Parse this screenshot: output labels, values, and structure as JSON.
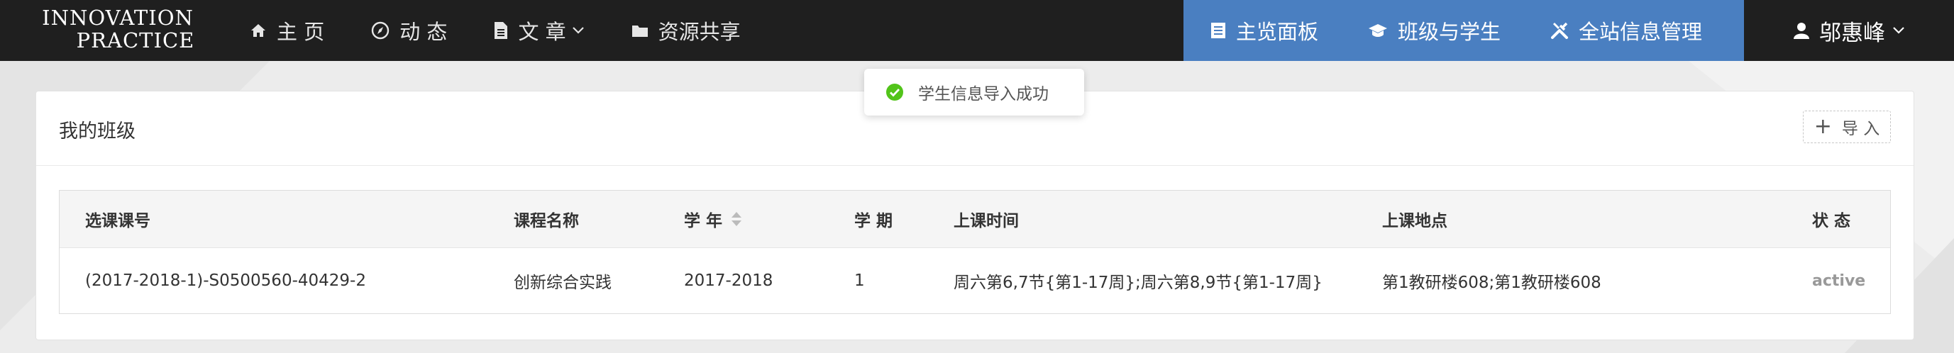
{
  "brand": {
    "line1": "INNOVATION",
    "line2": "PRACTICE"
  },
  "nav": {
    "items": [
      {
        "label": "主 页",
        "icon": "home-icon"
      },
      {
        "label": "动 态",
        "icon": "compass-icon"
      },
      {
        "label": "文 章",
        "icon": "document-icon"
      },
      {
        "label": "资源共享",
        "icon": "folder-icon"
      }
    ],
    "admin": [
      {
        "label": "主览面板",
        "icon": "list-icon"
      },
      {
        "label": "班级与学生",
        "icon": "graduation-cap-icon"
      },
      {
        "label": "全站信息管理",
        "icon": "wrench-icon"
      }
    ],
    "user": {
      "name": "邬惠峰",
      "icon": "user-icon"
    }
  },
  "toast": {
    "message": "学生信息导入成功",
    "icon": "check-circle-icon"
  },
  "card": {
    "title": "我的班级",
    "import_label": "导 入",
    "import_icon": "plus-icon"
  },
  "table": {
    "headers": [
      "选课课号",
      "课程名称",
      "学 年",
      "学 期",
      "上课时间",
      "上课地点",
      "状 态"
    ],
    "rows": [
      [
        "(2017-2018-1)-S0500560-40429-2",
        "创新综合实践",
        "2017-2018",
        "1",
        "周六第6,7节{第1-17周};周六第8,9节{第1-17周}",
        "第1教研楼608;第1教研楼608",
        "active"
      ]
    ]
  },
  "colors": {
    "navbar": "#1f1f1f",
    "admin_bar": "#4a7fc1",
    "success": "#52c41a",
    "background": "#ececec"
  }
}
